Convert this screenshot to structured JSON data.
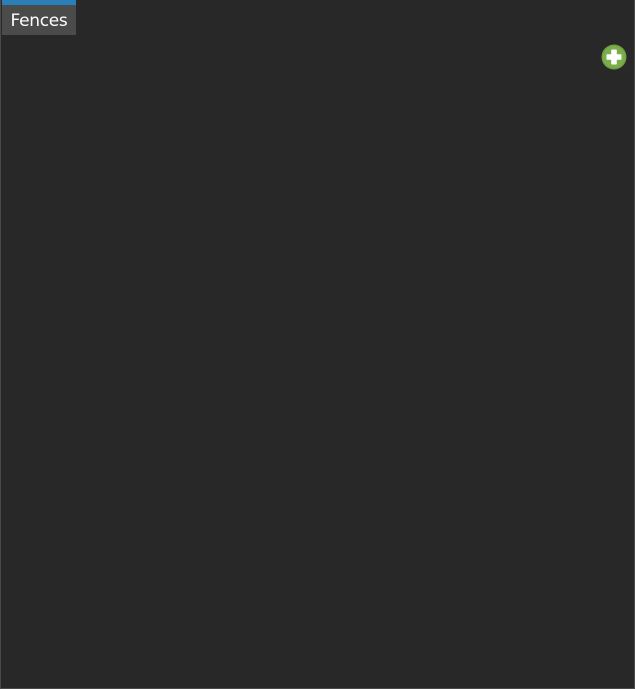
{
  "tab": {
    "label": "Fences",
    "accent_color": "#2b7fb8",
    "background_color": "#4b4b4b"
  },
  "canvas": {
    "background_color": "#282828"
  },
  "add_button": {
    "icon": "plus-circle-icon",
    "color": "#6fa043"
  }
}
